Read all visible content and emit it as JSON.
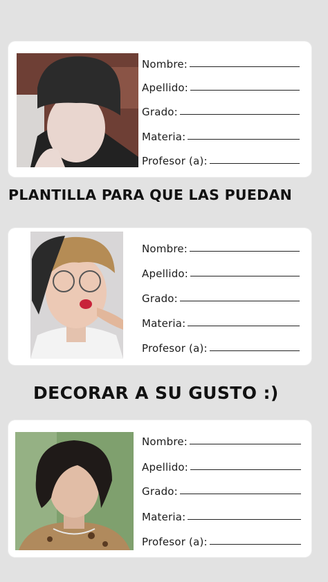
{
  "form_labels": {
    "name": "Nombre:",
    "surname": "Apellido:",
    "grade": "Grado:",
    "subject": "Materia:",
    "teacher": "Profesor (a):"
  },
  "captions": {
    "top": "PLANTILLA PARA QUE LAS PUEDAN",
    "middle": "DECORAR A SU GUSTO :)"
  }
}
